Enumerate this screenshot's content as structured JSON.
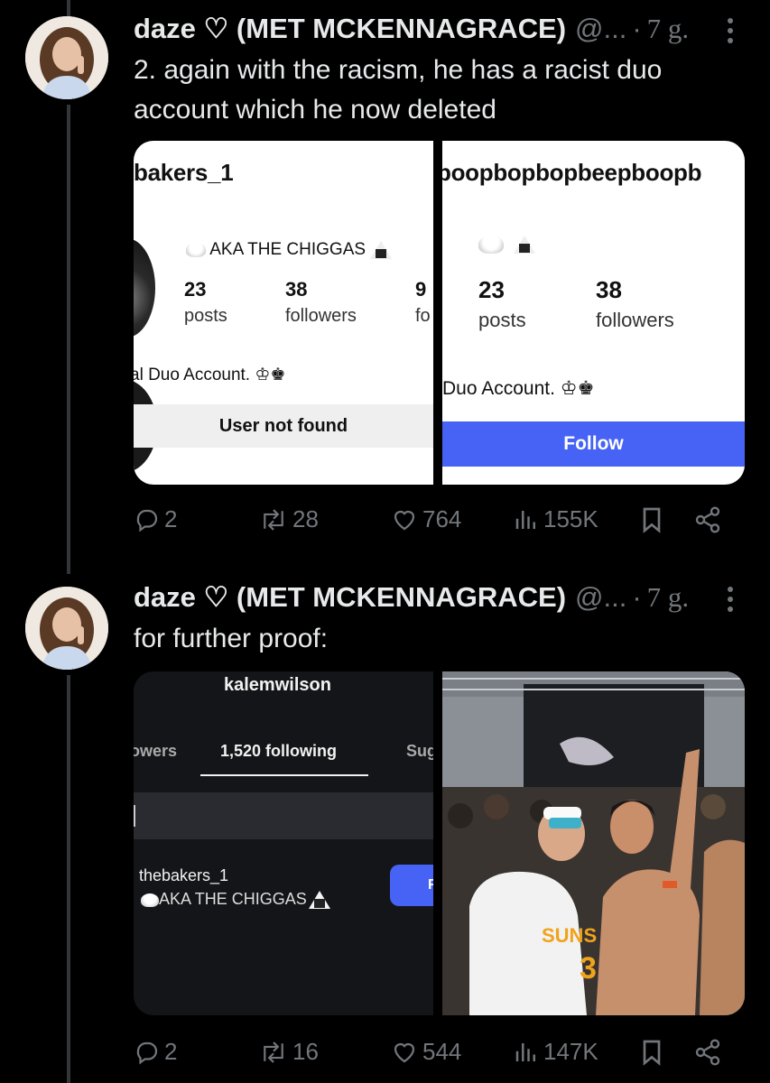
{
  "posts": [
    {
      "author_name": "daze ♡ (MET MCKENNAGRACE)",
      "handle": "@...",
      "time": "7 g.",
      "text": "2. again with the racism, he has a racist duo account which he now deleted",
      "media": {
        "left": {
          "username": "bakers_1",
          "bio_line": "AKA THE CHIGGAS",
          "posts_count": "23",
          "posts_label": "posts",
          "followers_count": "38",
          "followers_label": "followers",
          "following_count_partial": "9",
          "following_label_partial": "fo",
          "desc": "al Duo Account. ♔♚",
          "button": "User not found"
        },
        "right": {
          "username": "boopbopbopbeepboopb",
          "posts_count": "23",
          "posts_label": "posts",
          "followers_count": "38",
          "followers_label": "followers",
          "desc": "Duo Account. ♔♚",
          "button": "Follow"
        }
      },
      "stats": {
        "replies": "2",
        "reposts": "28",
        "likes": "764",
        "views": "155K"
      }
    },
    {
      "author_name": "daze ♡ (MET MCKENNAGRACE)",
      "handle": "@...",
      "time": "7 g.",
      "text": "for further proof:",
      "media": {
        "left": {
          "title": "kalemwilson",
          "tab_left": "owers",
          "tab_active": "1,520 following",
          "tab_right": "Sug",
          "result_username": "thebakers_1",
          "result_bio": "AKA THE CHIGGAS",
          "button_partial": "F"
        },
        "right": {
          "banner_text": "SUNS",
          "jersey_number": "3"
        }
      },
      "stats": {
        "replies": "2",
        "reposts": "16",
        "likes": "544",
        "views": "147K"
      }
    }
  ],
  "colors": {
    "accent_follow": "#4763f5",
    "muted": "#71767b",
    "thread_line": "#333639"
  }
}
